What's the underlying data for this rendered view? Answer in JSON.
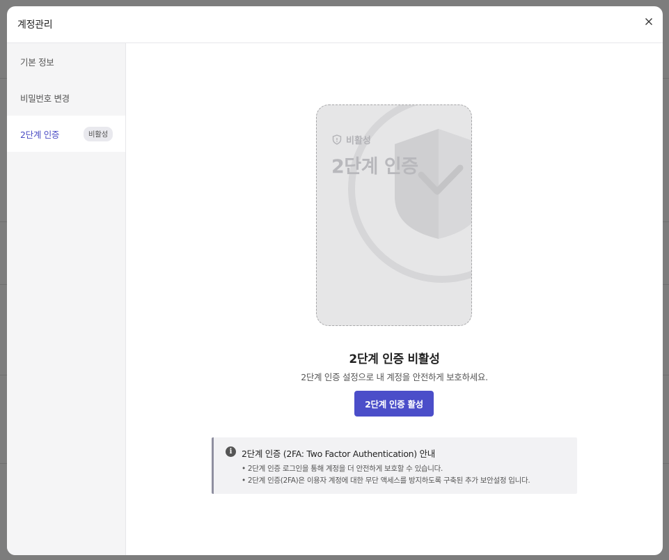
{
  "modal": {
    "title": "계정관리",
    "close_icon": "close-icon"
  },
  "sidebar": {
    "items": [
      {
        "label": "기본 정보",
        "active": false
      },
      {
        "label": "비밀번호 변경",
        "active": false
      },
      {
        "label": "2단계 인증",
        "active": true,
        "badge": "비활성"
      }
    ]
  },
  "card": {
    "status": "비활성",
    "status_icon": "shield-icon",
    "title": "2단계 인증",
    "deco_icon": "shield-check-icon"
  },
  "status": {
    "title": "2단계 인증 비활성",
    "description": "2단계 인증 설정으로 내 계정을 안전하게 보호하세요.",
    "button": "2단계 인증 활성"
  },
  "info": {
    "icon": "info-icon",
    "title": "2단계 인증 (2FA: Two Factor Authentication) 안내",
    "lines": [
      "• 2단계 인증 로그인을 통해 계정을 더 안전하게 보호할 수 있습니다.",
      "• 2단계 인증(2FA)은 이용자 계정에 대한 무단 액세스를 방지하도록 구축된 추가 보안설정 입니다."
    ]
  },
  "colors": {
    "accent": "#4b4ec9",
    "overlay": "#7d7d7d",
    "card_bg": "#e6e6e7"
  }
}
